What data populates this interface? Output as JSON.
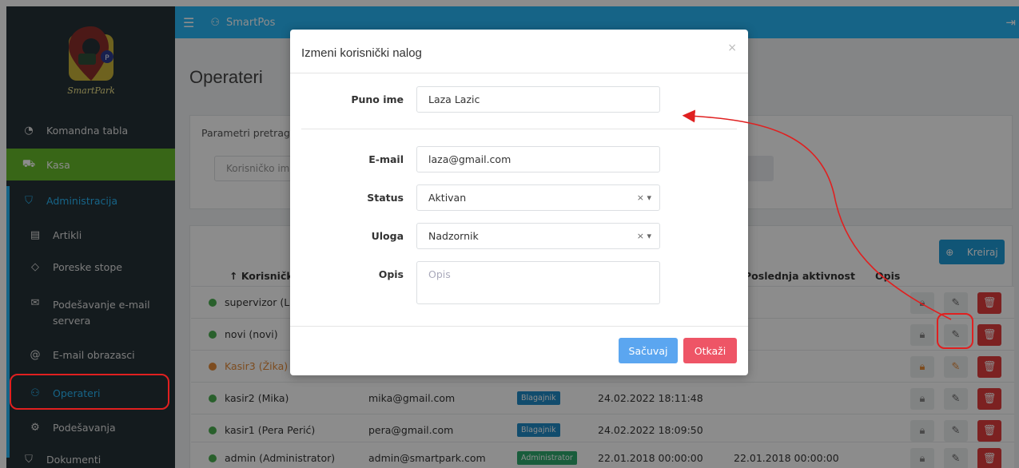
{
  "app": {
    "title": "SmartPos",
    "logo_text": "SmartPark"
  },
  "colors": {
    "accent": "#29b6f6",
    "active": "#66bb2a",
    "danger": "#e23c3c",
    "sidebar": "#263238"
  },
  "sidebar": {
    "items": [
      {
        "label": "Komandna tabla",
        "icon": "dashboard-icon"
      },
      {
        "label": "Kasa",
        "icon": "cart-icon"
      },
      {
        "label": "Administracija",
        "icon": "shield-icon"
      },
      {
        "label": "Artikli",
        "icon": "book-icon"
      },
      {
        "label": "Poreske stope",
        "icon": "tag-icon"
      },
      {
        "label": "Podešavanje e-mail servera",
        "icon": "mail-icon"
      },
      {
        "label": "E-mail obrazasci",
        "icon": "at-icon"
      },
      {
        "label": "Operateri",
        "icon": "users-icon"
      },
      {
        "label": "Podešavanja",
        "icon": "gear-icon"
      },
      {
        "label": "Dokumenti",
        "icon": "shield-icon"
      }
    ]
  },
  "page": {
    "title": "Operateri",
    "filter_title": "Parametri pretrage",
    "filter_placeholder": "Korisničko ime",
    "create_label": "Kreiraj",
    "columns": [
      "↑ Korisničko ime",
      "Poslednja aktivnost",
      "Opis"
    ],
    "rows": [
      {
        "name": "supervizor (La",
        "email": "",
        "role": "",
        "created": "",
        "last": "",
        "status": "active"
      },
      {
        "name": "novi (novi)",
        "email": "",
        "role": "",
        "created": "",
        "last": "",
        "status": "active"
      },
      {
        "name": "Kasir3 (Žika)",
        "email": "",
        "role": "",
        "created": "",
        "last": "",
        "status": "warning"
      },
      {
        "name": "kasir2 (Mika)",
        "email": "mika@gmail.com",
        "role": "Blagajnik",
        "created": "24.02.2022 18:11:48",
        "last": "",
        "status": "active"
      },
      {
        "name": "kasir1 (Pera Perić)",
        "email": "pera@gmail.com",
        "role": "Blagajnik",
        "created": "24.02.2022 18:09:50",
        "last": "",
        "status": "active"
      },
      {
        "name": "admin (Administrator)",
        "email": "admin@smartpark.com",
        "role": "Administrator",
        "created": "22.01.2018 00:00:00",
        "last": "22.01.2018 00:00:00",
        "status": "active"
      }
    ]
  },
  "modal": {
    "title": "Izmeni korisnički nalog",
    "close": "×",
    "fields": {
      "full_name_label": "Puno ime",
      "full_name_value": "Laza Lazic",
      "email_label": "E-mail",
      "email_value": "laza@gmail.com",
      "status_label": "Status",
      "status_value": "Aktivan",
      "role_label": "Uloga",
      "role_value": "Nadzornik",
      "desc_label": "Opis",
      "desc_placeholder": "Opis"
    },
    "save_label": "Sačuvaj",
    "cancel_label": "Otkaži"
  }
}
